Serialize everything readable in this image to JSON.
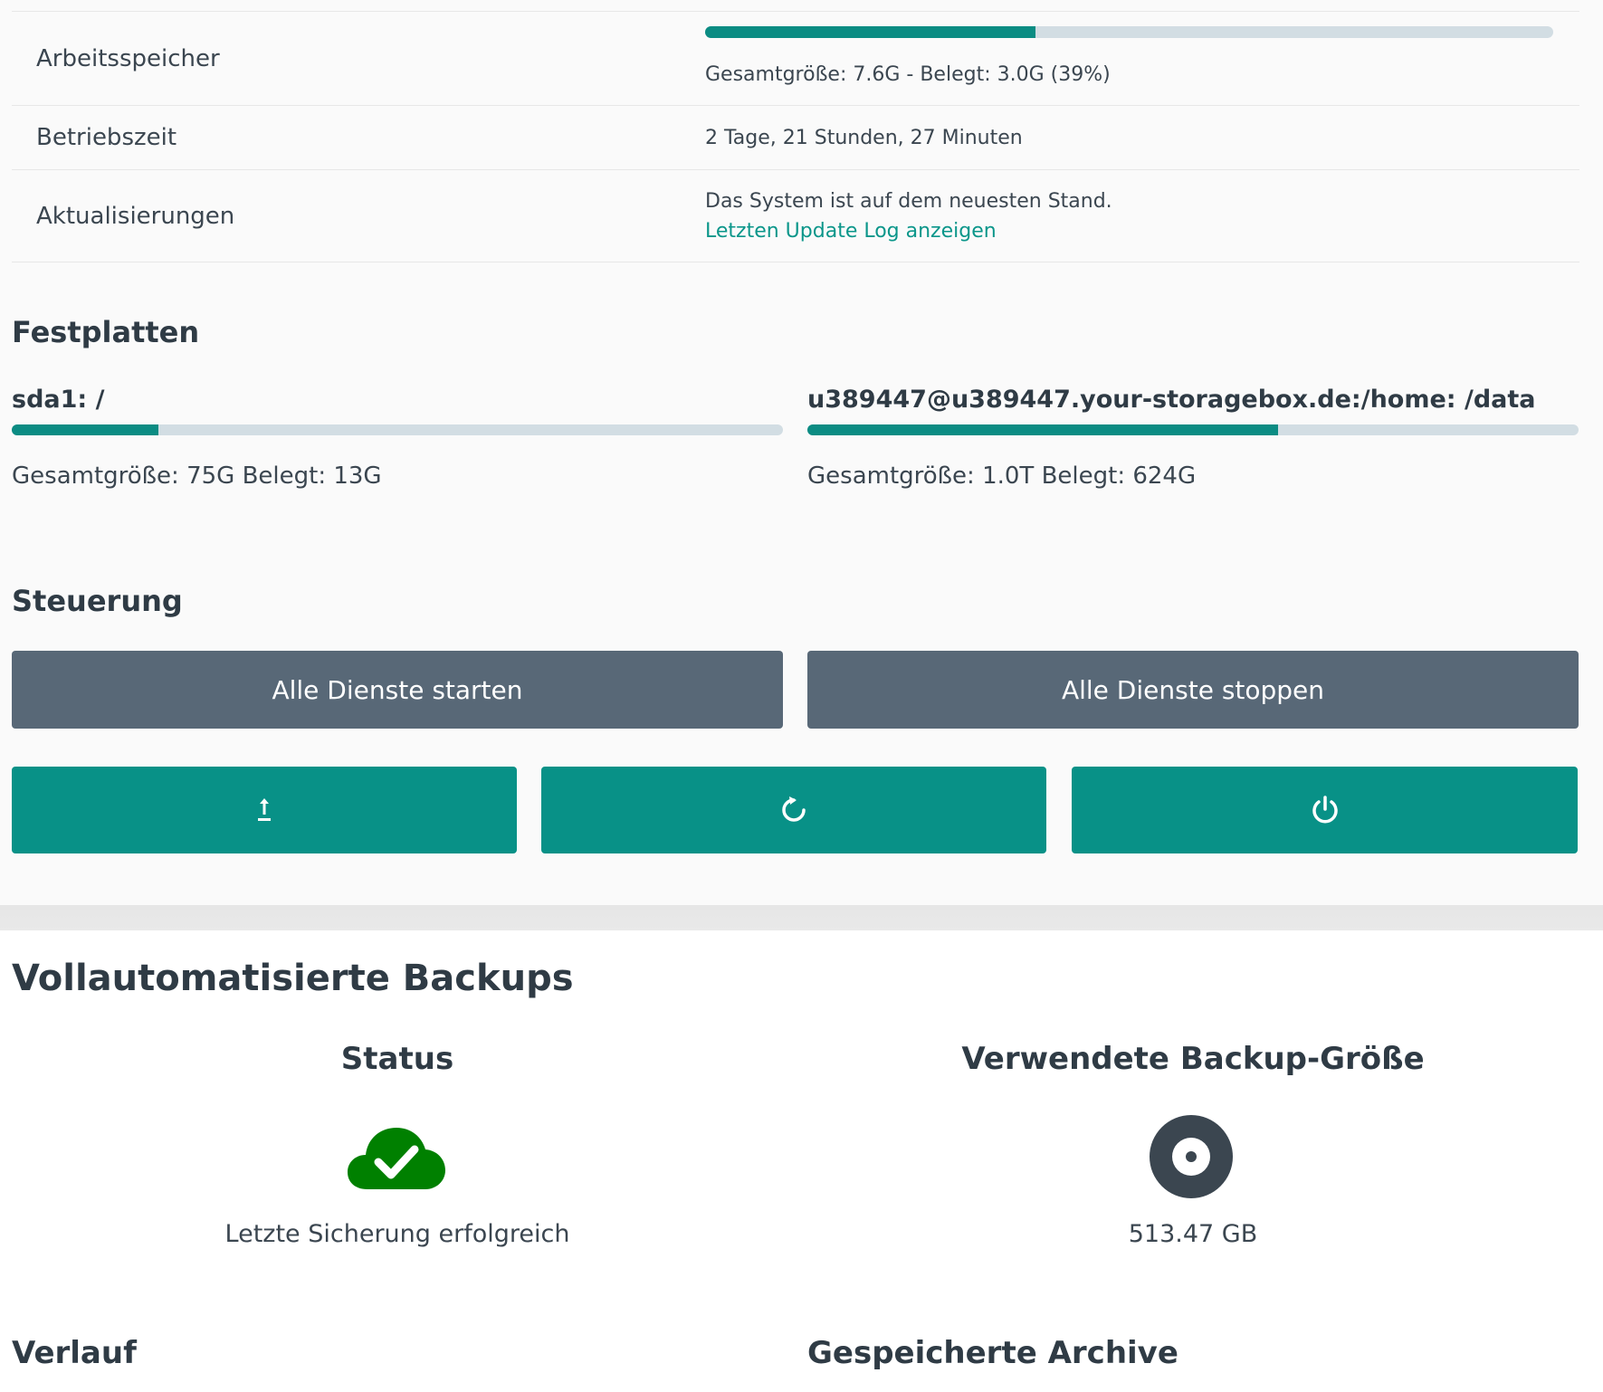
{
  "system_info": {
    "memory": {
      "label": "Arbeitsspeicher",
      "detail": "Gesamtgröße: 7.6G - Belegt: 3.0G (39%)",
      "used_fraction": 0.39
    },
    "uptime": {
      "label": "Betriebszeit",
      "value": "2 Tage, 21 Stunden, 27 Minuten"
    },
    "updates": {
      "label": "Aktualisierungen",
      "status": "Das System ist auf dem neuesten Stand.",
      "log_link": "Letzten Update Log anzeigen"
    }
  },
  "disks": {
    "title": "Festplatten",
    "items": [
      {
        "name": "sda1: /",
        "detail": "Gesamtgröße: 75G Belegt: 13G",
        "used_fraction": 0.19
      },
      {
        "name": "u389447@u389447.your-storagebox.de:/home: /data",
        "detail": "Gesamtgröße: 1.0T Belegt: 624G",
        "used_fraction": 0.61
      }
    ]
  },
  "controls": {
    "title": "Steuerung",
    "start_all": "Alle Dienste starten",
    "stop_all": "Alle Dienste stoppen",
    "icon_buttons": [
      "upload-icon",
      "restart-icon",
      "power-icon"
    ]
  },
  "backups": {
    "title": "Vollautomatisierte Backups",
    "status": {
      "title": "Status",
      "icon": "cloud-check-icon",
      "text": "Letzte Sicherung erfolgreich"
    },
    "size": {
      "title": "Verwendete Backup-Größe",
      "icon": "disk-icon",
      "value": "513.47 GB"
    },
    "history_title": "Verlauf",
    "archives_title": "Gespeicherte Archive"
  },
  "colors": {
    "teal": "#089187",
    "grey_button": "#586877",
    "bar_track": "#d2dde3",
    "success_green": "#008000",
    "link": "#0b968a"
  }
}
